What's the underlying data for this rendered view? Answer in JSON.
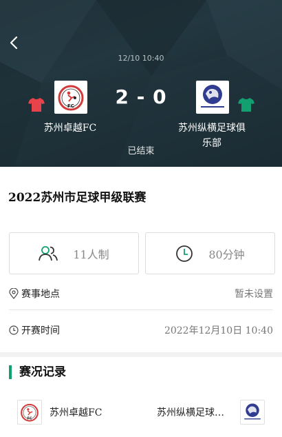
{
  "header": {
    "match_time": "12/10 10:40",
    "home_score": "2",
    "away_score": "0",
    "score_separator": "-",
    "status": "已结束",
    "home_team": "苏州卓越FC",
    "away_team": "苏州纵横足球俱乐部",
    "home_jersey_color": "#e8424a",
    "away_jersey_color": "#12a070",
    "icons": {
      "back": "back-arrow-icon"
    }
  },
  "league": {
    "title": "2022苏州市足球甲级联赛",
    "format": "11人制",
    "duration": "80分钟",
    "venue_label": "赛事地点",
    "venue_value": "暂未设置",
    "start_label": "开赛时间",
    "start_value": "2022年12月10日 10:40"
  },
  "records": {
    "title": "赛况记录",
    "home_team": "苏州卓越FC",
    "away_team": "苏州纵横足球俱乐部"
  },
  "colors": {
    "accent": "#12a070"
  }
}
